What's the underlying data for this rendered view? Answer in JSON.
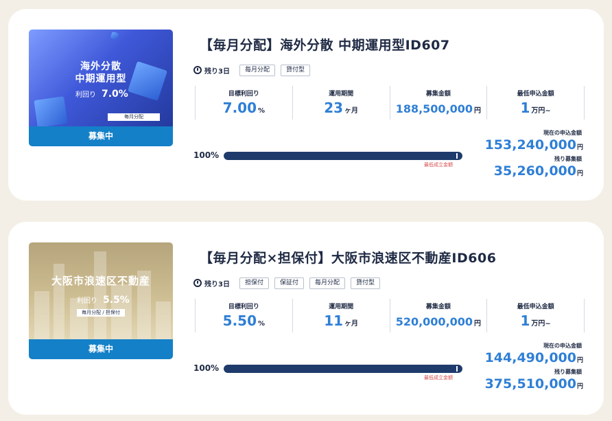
{
  "projects": [
    {
      "thumb_title_1": "海外分散",
      "thumb_title_2": "中期運用型",
      "thumb_rate_label": "利回り",
      "thumb_rate_value": "7.0%",
      "thumb_tag": "毎月分配",
      "status": "募集中",
      "title": "【毎月分配】海外分散 中期運用型ID607",
      "remaining": "残り3日",
      "tags": [
        "毎月分配",
        "貸付型"
      ],
      "stats": [
        {
          "label": "目標利回り",
          "value": "7.00",
          "unit": "%"
        },
        {
          "label": "運用期間",
          "value": "23",
          "unit": "ヶ月"
        },
        {
          "label": "募集金額",
          "value": "188,500,000",
          "unit": "円"
        },
        {
          "label": "最低申込金額",
          "value": "1",
          "unit": "万円~"
        }
      ],
      "progress_label": "100%",
      "progress_fraction": 1.0,
      "min_label": "最低成立金額",
      "current_label": "現在の申込金額",
      "current_value": "153,240,000",
      "remain_label": "残り募集額",
      "remain_value": "35,260,000",
      "yen": "円"
    },
    {
      "thumb_title_1": "大阪市浪速区不動産",
      "thumb_rate_label": "利回り",
      "thumb_rate_value": "5.5%",
      "thumb_tag": "毎月分配 / 担保付",
      "status": "募集中",
      "title": "【毎月分配×担保付】大阪市浪速区不動産ID606",
      "remaining": "残り3日",
      "tags": [
        "担保付",
        "保証付",
        "毎月分配",
        "貸付型"
      ],
      "stats": [
        {
          "label": "目標利回り",
          "value": "5.50",
          "unit": "%"
        },
        {
          "label": "運用期間",
          "value": "11",
          "unit": "ヶ月"
        },
        {
          "label": "募集金額",
          "value": "520,000,000",
          "unit": "円"
        },
        {
          "label": "最低申込金額",
          "value": "1",
          "unit": "万円~"
        }
      ],
      "progress_label": "100%",
      "progress_fraction": 1.0,
      "min_label": "最低成立金額",
      "current_label": "現在の申込金額",
      "current_value": "144,490,000",
      "remain_label": "残り募集額",
      "remain_value": "375,510,000",
      "yen": "円"
    }
  ]
}
